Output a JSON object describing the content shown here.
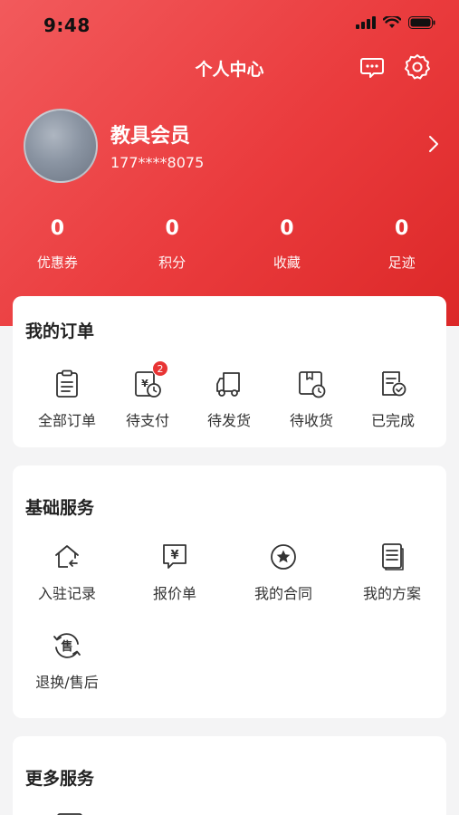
{
  "status_bar": {
    "time": "9:48"
  },
  "nav": {
    "title": "个人中心",
    "message_icon": "message-icon",
    "settings_icon": "gear-icon"
  },
  "profile": {
    "name": "教具会员",
    "phone": "177****8075"
  },
  "stats": [
    {
      "value": "0",
      "label": "优惠券"
    },
    {
      "value": "0",
      "label": "积分"
    },
    {
      "value": "0",
      "label": "收藏"
    },
    {
      "value": "0",
      "label": "足迹"
    }
  ],
  "orders": {
    "title": "我的订单",
    "items": [
      {
        "label": "全部订单",
        "icon": "clipboard-icon"
      },
      {
        "label": "待支付",
        "icon": "payment-clock-icon",
        "badge": "2"
      },
      {
        "label": "待发货",
        "icon": "truck-icon"
      },
      {
        "label": "待收货",
        "icon": "package-clock-icon"
      },
      {
        "label": "已完成",
        "icon": "document-check-icon"
      }
    ]
  },
  "basic_services": {
    "title": "基础服务",
    "items": [
      {
        "label": "入驻记录",
        "icon": "house-enter-icon"
      },
      {
        "label": "报价单",
        "icon": "quote-yen-icon"
      },
      {
        "label": "我的合同",
        "icon": "star-seal-icon"
      },
      {
        "label": "我的方案",
        "icon": "document-list-icon"
      },
      {
        "label": "退换/售后",
        "icon": "after-sale-icon",
        "icon_text": "售"
      }
    ]
  },
  "more_services": {
    "title": "更多服务"
  },
  "colors": {
    "brand_red": "#e83b3d",
    "badge_red": "#e83434"
  }
}
